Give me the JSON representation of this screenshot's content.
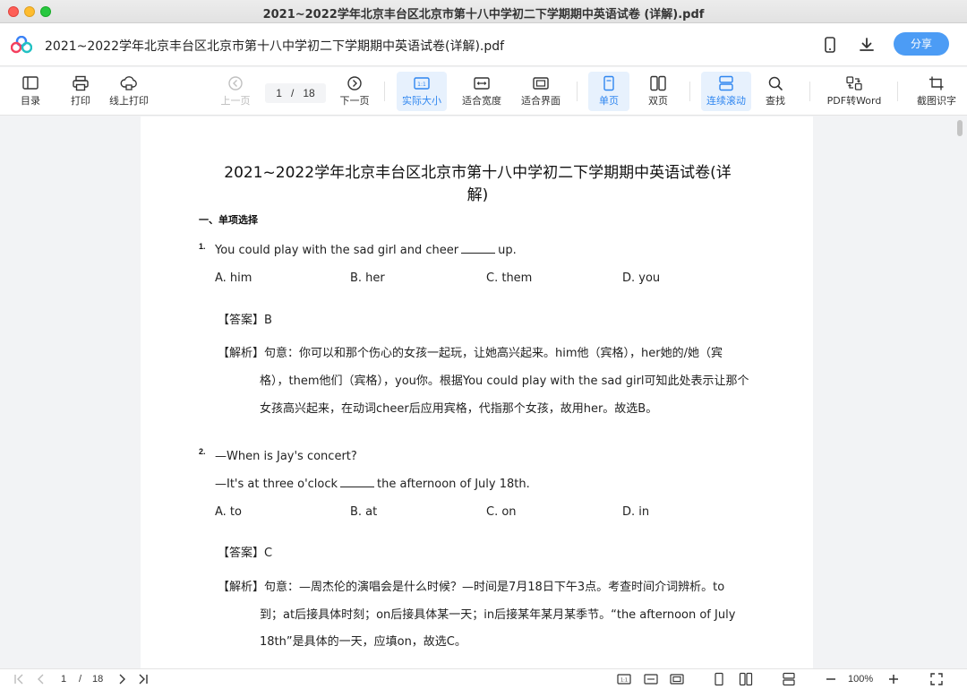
{
  "window": {
    "title": "2021~2022学年北京丰台区北京市第十八中学初二下学期期中英语试卷 (详解).pdf"
  },
  "header": {
    "doc_title": "2021~2022学年北京丰台区北京市第十八中学初二下学期期中英语试卷(详解).pdf",
    "share_label": "分享",
    "icons": [
      "mobile-icon",
      "download-icon"
    ]
  },
  "toolbar": {
    "toc": "目录",
    "print": "打印",
    "online_print": "线上打印",
    "prev_page": "上一页",
    "current_page": "1",
    "page_sep": "/",
    "total_pages": "18",
    "next_page": "下一页",
    "actual_size": "实际大小",
    "fit_width": "适合宽度",
    "fit_page": "适合界面",
    "single_page": "单页",
    "double_page": "双页",
    "continuous": "连续滚动",
    "find": "查找",
    "pdf_to_word": "PDF转Word",
    "ocr": "截图识字",
    "accent_color": "#2f86f0"
  },
  "document": {
    "title": "2021~2022学年北京丰台区北京市第十八中学初二下学期期中英语试卷(详解)",
    "section": "一、单项选择",
    "q1": {
      "num": "1.",
      "stem_a": "You could play with the sad girl and cheer",
      "stem_b": "up.",
      "options": [
        "A. him",
        "B. her",
        "C. them",
        "D. you"
      ],
      "answer_label": "【答案】",
      "answer": "B",
      "analysis_label": "【解析】",
      "analysis": [
        "句意：你可以和那个伤心的女孩一起玩，让她高兴起来。him他（宾格），her她的/她（宾",
        "格），them他们（宾格），you你。根据You could play with the sad girl可知此处表示让那个",
        "女孩高兴起来，在动词cheer后应用宾格，代指那个女孩，故用her。故选B。"
      ]
    },
    "q2": {
      "num": "2.",
      "line1": "—When is Jay's concert?",
      "line2_a": "—It's at three o'clock",
      "line2_b": "the afternoon of July 18th.",
      "options": [
        "A. to",
        "B. at",
        "C. on",
        "D. in"
      ],
      "answer_label": "【答案】",
      "answer": "C",
      "analysis_label": "【解析】",
      "analysis": [
        "句意：—周杰伦的演唱会是什么时候？—时间是7月18日下午3点。考查时间介词辨析。to",
        "到；at后接具体时刻；on后接具体某一天；in后接某年某月某季节。“the afternoon of July",
        "18th”是具体的一天，应填on，故选C。"
      ]
    }
  },
  "statusbar": {
    "current_page": "1",
    "page_sep": "/",
    "total_pages": "18",
    "zoom": "100%"
  }
}
